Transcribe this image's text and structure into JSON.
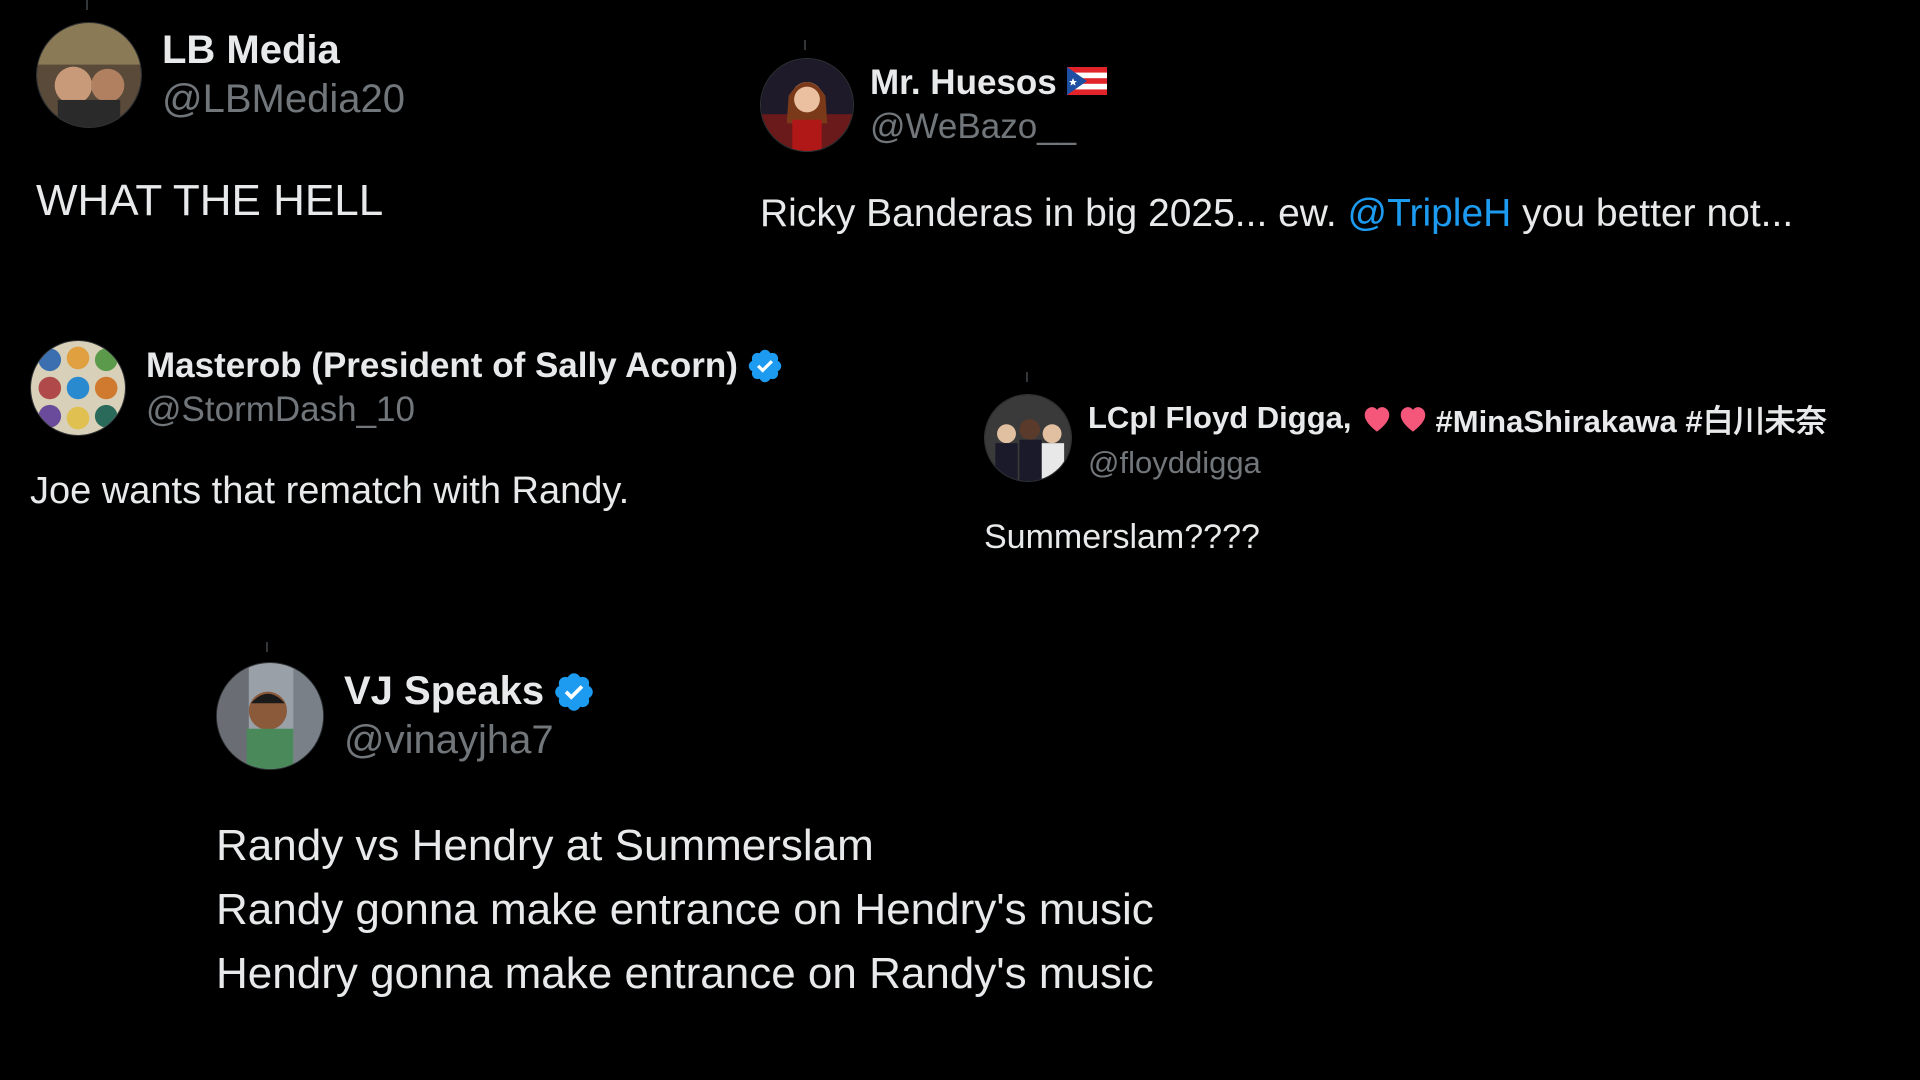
{
  "tweets": [
    {
      "name": "LB Media",
      "handle": "@LBMedia20",
      "text": "WHAT THE HELL",
      "verified": false
    },
    {
      "name": "Mr. Huesos",
      "flag_icon": "puerto-rico-flag-icon",
      "handle": "@WeBazo__",
      "text_before": "Ricky Banderas in big 2025... ew. ",
      "mention": "@TripleH",
      "text_after": " you better not...",
      "verified": false
    },
    {
      "name": "Masterob (President of Sally Acorn)",
      "handle": "@StormDash_10",
      "text": "Joe wants that rematch with Randy.",
      "verified": true
    },
    {
      "name": "LCpl Floyd Digga,",
      "hashtags": "#MinaShirakawa #白川未奈",
      "handle": "@floyddigga",
      "text": "Summerslam????",
      "verified": false
    },
    {
      "name": "VJ Speaks",
      "handle": "@vinayjha7",
      "lines": [
        "Randy vs Hendry at Summerslam",
        "Randy gonna make entrance on Hendry's music",
        "Hendry gonna make entrance on Randy's music"
      ],
      "verified": true
    }
  ],
  "colors": {
    "background": "#000000",
    "text": "#e7e9ea",
    "handle": "#71767b",
    "link": "#1d9bf0",
    "verified": "#1d9bf0",
    "heart": "#f4577a"
  }
}
